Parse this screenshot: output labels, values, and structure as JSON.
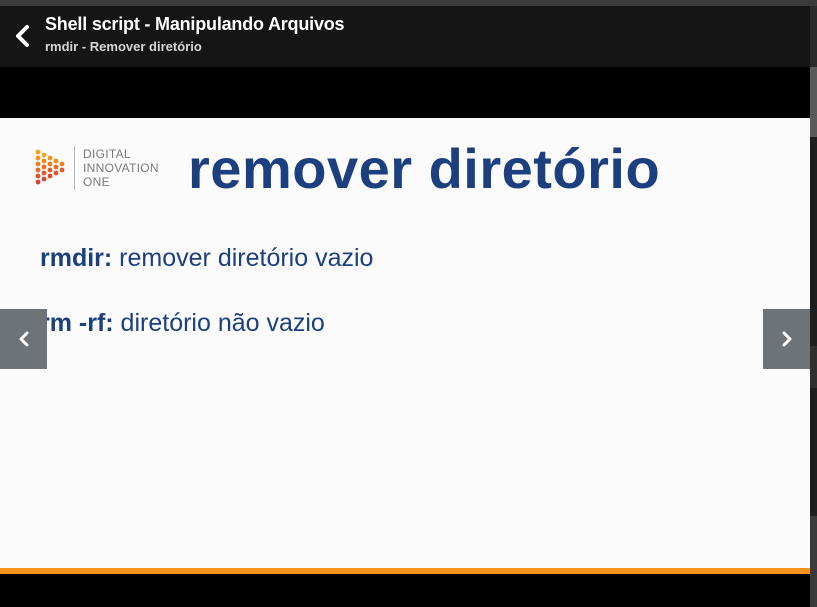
{
  "header": {
    "title": "Shell script - Manipulando Arquivos",
    "subtitle": "rmdir - Remover diretório"
  },
  "slide": {
    "logo_lines": [
      "DIGITAL",
      "INNOVATION",
      "ONE"
    ],
    "heading": "remover diretório",
    "items": [
      {
        "command": "rmdir:",
        "description": " remover diretório vazio"
      },
      {
        "command": "rm -rf:",
        "description": " diretório não vazio"
      }
    ]
  },
  "icons": {
    "back": "chevron-left-icon",
    "prev": "chevron-left-icon",
    "next": "chevron-right-icon"
  },
  "colors": {
    "heading": "#1c3f7f",
    "accent_bar": "#f7941d",
    "header_bg": "#151515",
    "nav_button": "#6e7378"
  }
}
